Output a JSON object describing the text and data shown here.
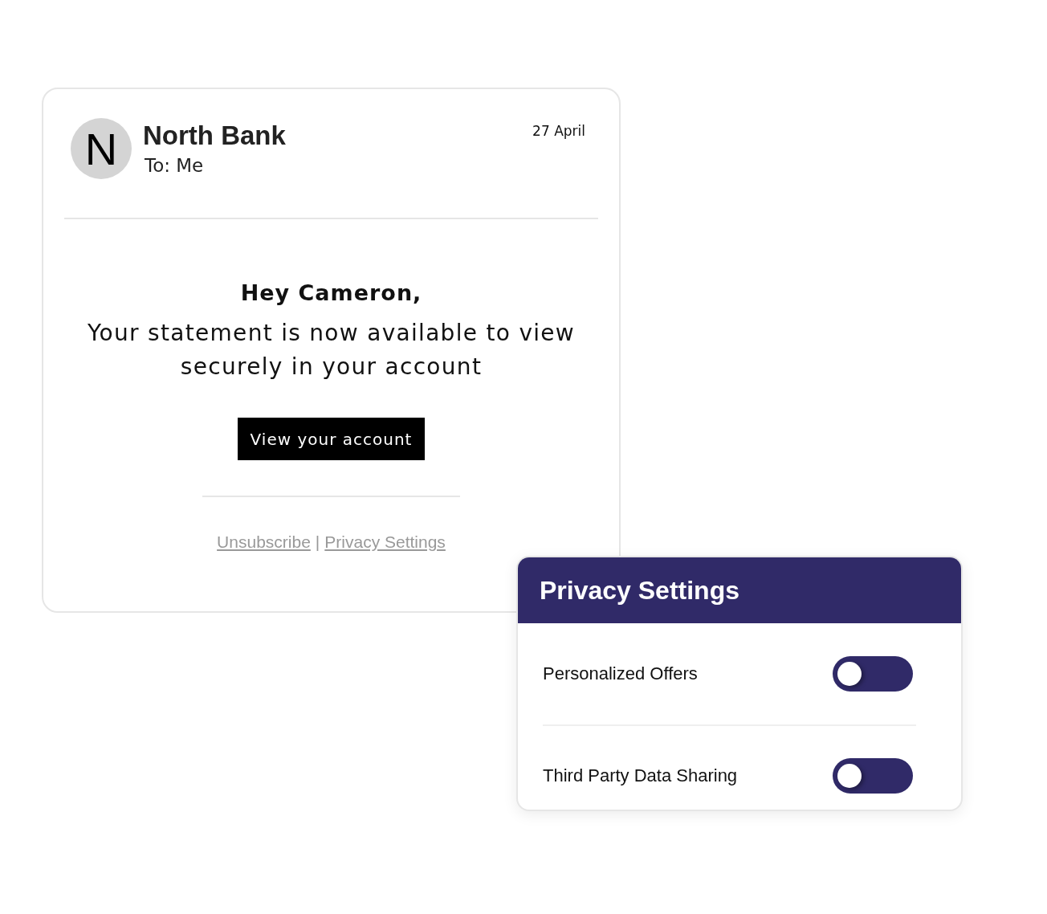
{
  "email": {
    "avatar_letter": "N",
    "sender": "North Bank",
    "recipient": "To: Me",
    "date": "27 April",
    "greeting": "Hey Cameron,",
    "message": "Your statement is now available to view securely in your account",
    "button": "View your account",
    "footer_links": [
      {
        "label": "Unsubscribe"
      },
      {
        "label": "Privacy Settings"
      }
    ],
    "footer_separator": "|"
  },
  "privacy_panel": {
    "title": "Privacy Settings",
    "settings": [
      {
        "label": "Personalized Offers",
        "on": false
      },
      {
        "label": "Third Party Data Sharing",
        "on": false
      }
    ]
  }
}
